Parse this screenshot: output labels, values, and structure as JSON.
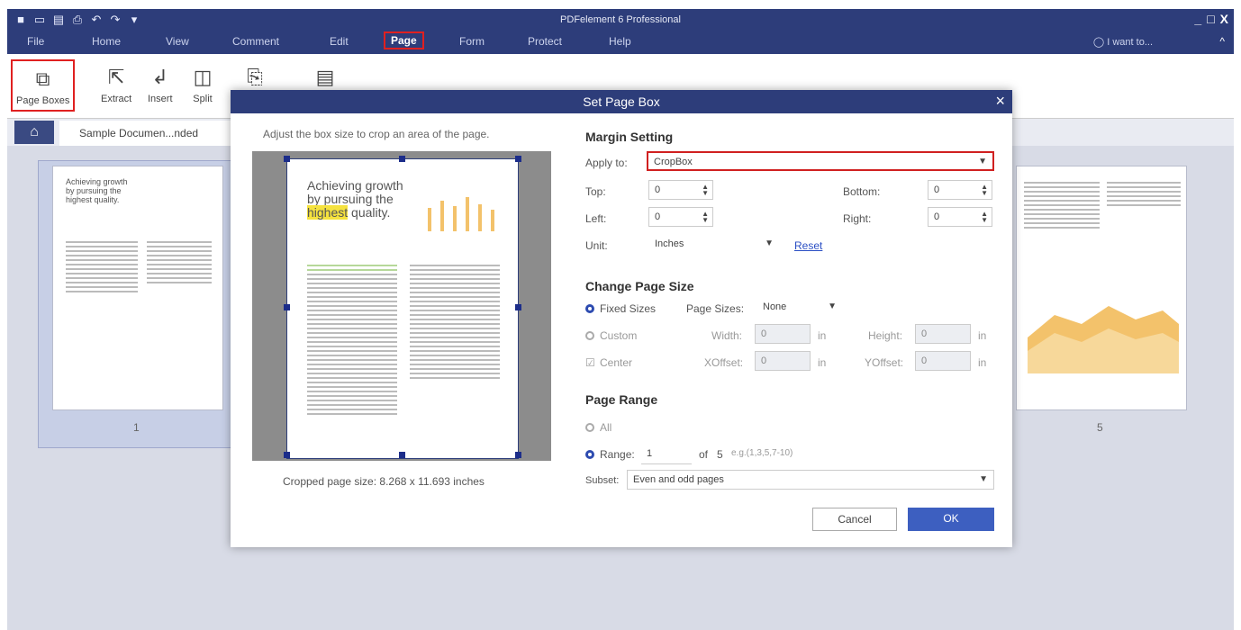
{
  "app": {
    "title": "PDFelement 6 Professional",
    "iwant": "I want to...",
    "window_controls": [
      "_",
      "□",
      "X"
    ],
    "collapse": "^"
  },
  "quick_access_icons": [
    "app-logo-icon",
    "open-icon",
    "save-icon",
    "print-icon",
    "undo-icon",
    "redo-icon",
    "dropdown-icon"
  ],
  "menu": {
    "items": [
      "File",
      "Home",
      "View",
      "Comment",
      "Edit",
      "Page",
      "Form",
      "Protect",
      "Help"
    ],
    "active": "Page"
  },
  "ribbon": {
    "page_boxes": "Page Boxes",
    "extract": "Extract",
    "insert": "Insert",
    "split": "Split"
  },
  "tabs": {
    "doc": "Sample Documen...nded"
  },
  "thumbnails": {
    "page1_number": "1",
    "page5_number": "5",
    "page1_title": [
      "Achieving growth",
      "by pursuing the",
      "highest quality."
    ]
  },
  "dialog": {
    "title": "Set Page Box",
    "close": "×",
    "hint": "Adjust the box size to crop an area of the page.",
    "cropped_size": "Cropped page size: 8.268 x 11.693 inches",
    "preview_title": [
      "Achieving growth",
      "by pursuing the",
      "highest",
      " quality."
    ],
    "margin": {
      "header": "Margin Setting",
      "apply_to_label": "Apply to:",
      "apply_to_value": "CropBox",
      "top_label": "Top:",
      "top_value": "0",
      "bottom_label": "Bottom:",
      "bottom_value": "0",
      "left_label": "Left:",
      "left_value": "0",
      "right_label": "Right:",
      "right_value": "0",
      "unit_label": "Unit:",
      "unit_value": "Inches",
      "reset": "Reset"
    },
    "page_size": {
      "header": "Change Page Size",
      "fixed": "Fixed Sizes",
      "page_sizes_label": "Page Sizes:",
      "page_sizes_value": "None",
      "custom": "Custom",
      "width_label": "Width:",
      "width_value": "0",
      "height_label": "Height:",
      "height_value": "0",
      "unit_in": "in",
      "center": "Center",
      "xoffset_label": "XOffset:",
      "xoffset_value": "0",
      "yoffset_label": "YOffset:",
      "yoffset_value": "0"
    },
    "page_range": {
      "header": "Page Range",
      "all": "All",
      "range_label": "Range:",
      "range_value": "1",
      "of_label": "of",
      "of_total": "5",
      "example": "e.g.(1,3,5,7-10)",
      "subset_label": "Subset:",
      "subset_value": "Even and odd pages"
    },
    "cancel": "Cancel",
    "ok": "OK"
  },
  "colors": {
    "titlebar": "#2d3d7a",
    "highlight_red": "#e02020",
    "ok_button": "#3d5fc0",
    "chart_orange": "#f3c26b"
  }
}
